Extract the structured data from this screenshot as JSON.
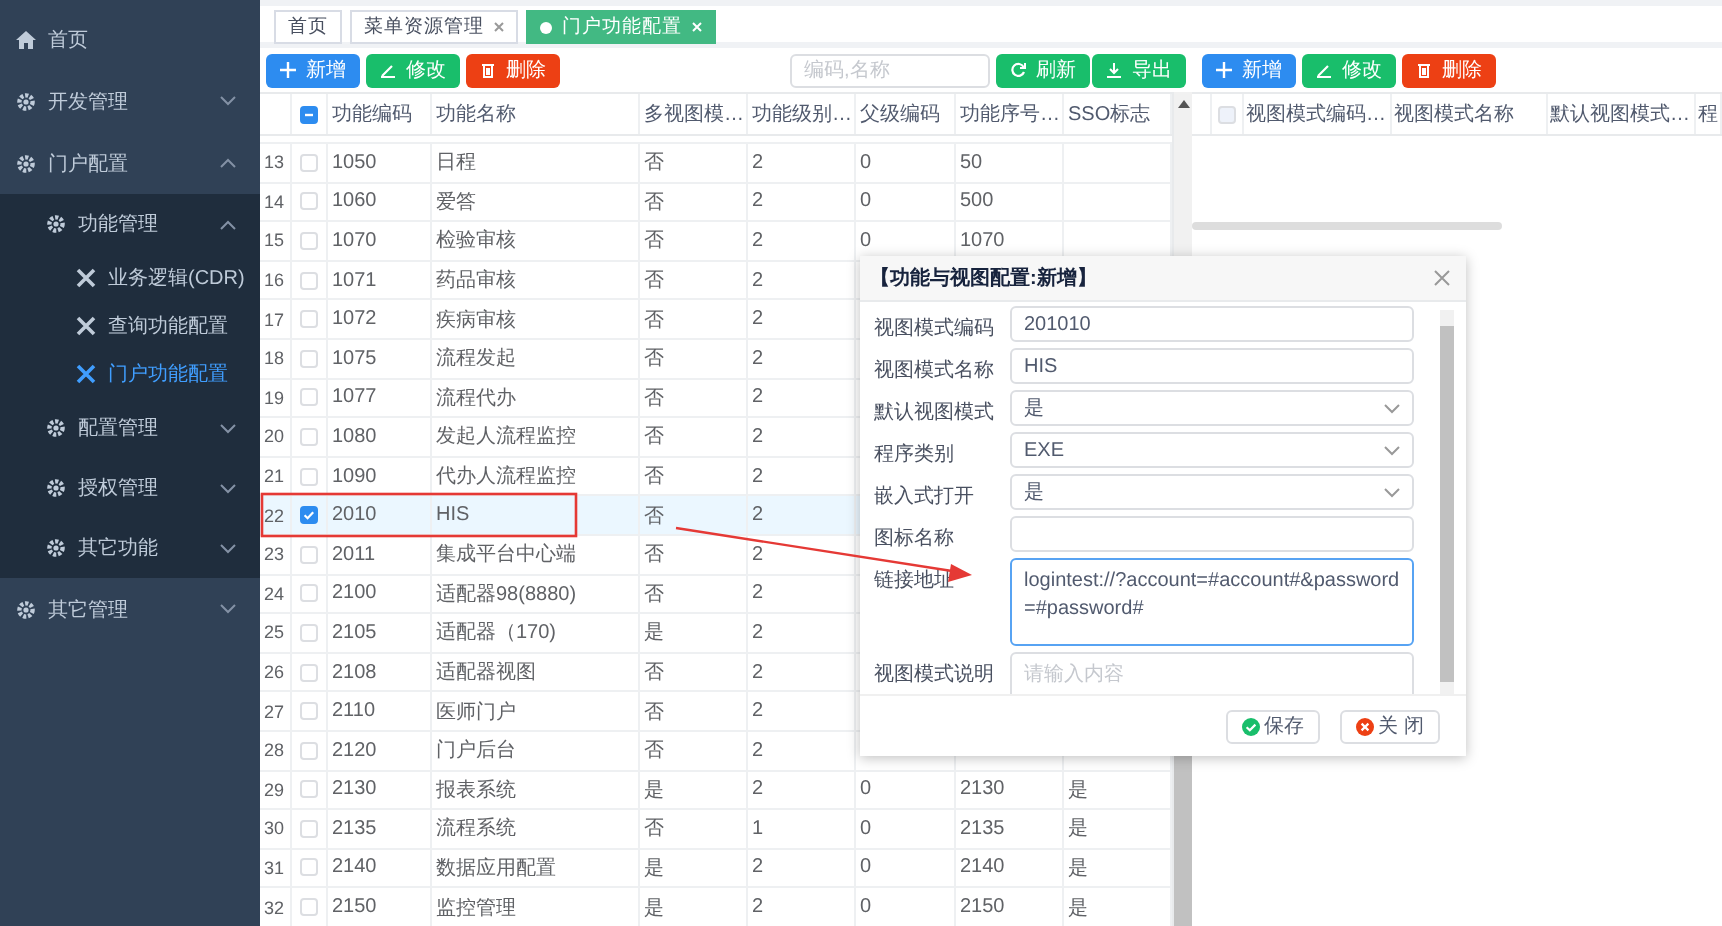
{
  "sidebar": {
    "items": [
      {
        "label": "首页",
        "kind": "home"
      },
      {
        "label": "开发管理",
        "kind": "menu",
        "expanded": false
      },
      {
        "label": "门户配置",
        "kind": "menu",
        "expanded": true,
        "children": [
          {
            "label": "功能管理",
            "kind": "menu",
            "expanded": true,
            "children": [
              {
                "label": "业务逻辑(CDR)",
                "kind": "page",
                "selected": false
              },
              {
                "label": "查询功能配置",
                "kind": "page",
                "selected": false
              },
              {
                "label": "门户功能配置",
                "kind": "page",
                "selected": true
              }
            ]
          },
          {
            "label": "配置管理",
            "kind": "menu",
            "expanded": false
          },
          {
            "label": "授权管理",
            "kind": "menu",
            "expanded": false
          },
          {
            "label": "其它功能",
            "kind": "menu",
            "expanded": false
          }
        ]
      },
      {
        "label": "其它管理",
        "kind": "menu",
        "expanded": false
      }
    ]
  },
  "tabs": [
    {
      "label": "首页",
      "selected": false,
      "closable": false
    },
    {
      "label": "菜单资源管理",
      "selected": false,
      "closable": true
    },
    {
      "label": "门户功能配置",
      "selected": true,
      "closable": true
    }
  ],
  "function_table": {
    "toolbar": [
      {
        "label": "新增",
        "kind": "add"
      },
      {
        "label": "修改",
        "kind": "edit"
      },
      {
        "label": "删除",
        "kind": "delete"
      }
    ],
    "search": {
      "placeholder": "编码,名称"
    },
    "actions": [
      {
        "label": "刷新",
        "kind": "refresh"
      },
      {
        "label": "导出",
        "kind": "export"
      }
    ],
    "select_all_indeterminate": true,
    "columns": [
      "功能编码",
      "功能名称",
      "多视图模…",
      "功能级别…",
      "父级编码",
      "功能序号…",
      "SSO标志"
    ],
    "rows": [
      {
        "number": "13",
        "checked": false,
        "selected": false,
        "cells": [
          "1050",
          "日程",
          "否",
          "2",
          "0",
          "50"
        ]
      },
      {
        "number": "14",
        "checked": false,
        "selected": false,
        "cells": [
          "1060",
          "爱答",
          "否",
          "2",
          "0",
          "500"
        ]
      },
      {
        "number": "15",
        "checked": false,
        "selected": false,
        "cells": [
          "1070",
          "检验审核",
          "否",
          "2",
          "0",
          "1070"
        ]
      },
      {
        "number": "16",
        "checked": false,
        "selected": false,
        "cells": [
          "1071",
          "药品审核",
          "否",
          "2"
        ]
      },
      {
        "number": "17",
        "checked": false,
        "selected": false,
        "cells": [
          "1072",
          "疾病审核",
          "否",
          "2"
        ]
      },
      {
        "number": "18",
        "checked": false,
        "selected": false,
        "cells": [
          "1075",
          "流程发起",
          "否",
          "2"
        ]
      },
      {
        "number": "19",
        "checked": false,
        "selected": false,
        "cells": [
          "1077",
          "流程代办",
          "否",
          "2"
        ]
      },
      {
        "number": "20",
        "checked": false,
        "selected": false,
        "cells": [
          "1080",
          "发起人流程监控",
          "否",
          "2"
        ]
      },
      {
        "number": "21",
        "checked": false,
        "selected": false,
        "cells": [
          "1090",
          "代办人流程监控",
          "否",
          "2"
        ]
      },
      {
        "number": "22",
        "checked": true,
        "selected": true,
        "cells": [
          "2010",
          "HIS",
          "否",
          "2"
        ]
      },
      {
        "number": "23",
        "checked": false,
        "selected": false,
        "cells": [
          "2011",
          "集成平台中心端",
          "否",
          "2"
        ]
      },
      {
        "number": "24",
        "checked": false,
        "selected": false,
        "cells": [
          "2100",
          "适配器98(8880)",
          "否",
          "2"
        ]
      },
      {
        "number": "25",
        "checked": false,
        "selected": false,
        "cells": [
          "2105",
          "适配器（170)",
          "是",
          "2"
        ]
      },
      {
        "number": "26",
        "checked": false,
        "selected": false,
        "cells": [
          "2108",
          "适配器视图",
          "否",
          "2"
        ]
      },
      {
        "number": "27",
        "checked": false,
        "selected": false,
        "cells": [
          "2110",
          "医师门户",
          "否",
          "2"
        ]
      },
      {
        "number": "28",
        "checked": false,
        "selected": false,
        "cells": [
          "2120",
          "门户后台",
          "否",
          "2"
        ]
      },
      {
        "number": "29",
        "checked": false,
        "selected": false,
        "cells": [
          "2130",
          "报表系统",
          "是",
          "2",
          "0",
          "2130",
          "是"
        ]
      },
      {
        "number": "30",
        "checked": false,
        "selected": false,
        "cells": [
          "2135",
          "流程系统",
          "否",
          "1",
          "0",
          "2135",
          "是"
        ]
      },
      {
        "number": "31",
        "checked": false,
        "selected": false,
        "cells": [
          "2140",
          "数据应用配置",
          "是",
          "2",
          "0",
          "2140",
          "是"
        ]
      },
      {
        "number": "32",
        "checked": false,
        "selected": false,
        "cells": [
          "2150",
          "监控管理",
          "是",
          "2",
          "0",
          "2150",
          "是"
        ]
      }
    ]
  },
  "view_table": {
    "toolbar": [
      {
        "label": "新增",
        "kind": "add"
      },
      {
        "label": "修改",
        "kind": "edit"
      },
      {
        "label": "删除",
        "kind": "delete"
      }
    ],
    "select_all_checked": false,
    "select_all_indeterminate": false,
    "columns": [
      "视图模式编码…",
      "视图模式名称",
      "默认视图模式…",
      "程"
    ]
  },
  "dialog": {
    "title": "【功能与视图配置:新增】",
    "fields": [
      {
        "label": "视图模式编码",
        "kind": "input",
        "value": "201010"
      },
      {
        "label": "视图模式名称",
        "kind": "input",
        "value": "HIS"
      },
      {
        "label": "默认视图模式",
        "kind": "select",
        "value": "是"
      },
      {
        "label": "程序类别",
        "kind": "select",
        "value": "EXE"
      },
      {
        "label": "嵌入式打开",
        "kind": "select",
        "value": "是"
      },
      {
        "label": "图标名称",
        "kind": "input"
      },
      {
        "label": "链接地址",
        "kind": "textarea",
        "value": "logintest://?account=#account#&password=#password#"
      },
      {
        "label": "视图模式说明",
        "kind": "textarea",
        "placeholder": "请输入内容"
      }
    ],
    "buttons": [
      {
        "label": "保存",
        "kind": "save"
      },
      {
        "label": "关 闭",
        "kind": "close"
      }
    ]
  }
}
